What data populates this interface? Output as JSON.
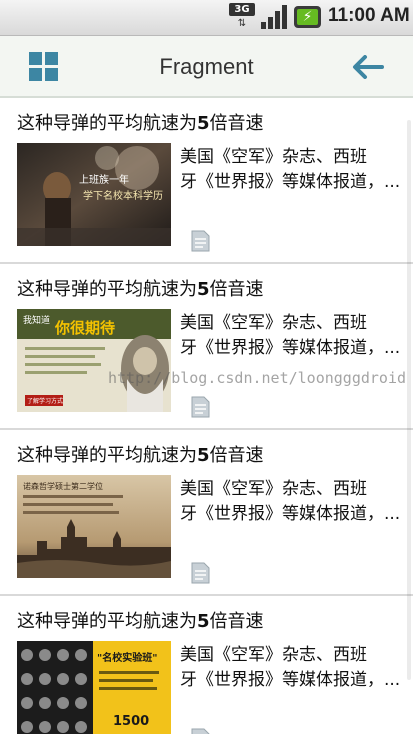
{
  "status_bar": {
    "network": "3G",
    "time": "11:00 AM",
    "icons": [
      "network-3g-icon",
      "signal-icon",
      "battery-charging-icon"
    ]
  },
  "action_bar": {
    "title": "Fragment",
    "left_icon": "grid-menu-icon",
    "right_icon": "back-arrow-icon",
    "accent_color": "#3d86a3"
  },
  "items": [
    {
      "title_pre": "这种导弹的平均航速为",
      "title_bold": "5",
      "title_post": "倍音速",
      "desc_line1": "美国《空军》杂志、西班",
      "desc_line2": "牙《世界报》等媒体报道，...",
      "image": "street-crowd-photo",
      "image_text": "上班族一年 学下名校本科学历"
    },
    {
      "title_pre": "这种导弹的平均航速为",
      "title_bold": "5",
      "title_post": "倍音速",
      "desc_line1": "美国《空军》杂志、西班",
      "desc_line2": "牙《世界报》等媒体报道，...",
      "image": "promo-darwin-poster",
      "image_text": "你很期待",
      "image_text2": "我知道",
      "image_button": "了解学习方式"
    },
    {
      "title_pre": "这种导弹的平均航速为",
      "title_bold": "5",
      "title_post": "倍音速",
      "desc_line1": "美国《空军》杂志、西班",
      "desc_line2": "牙《世界报》等媒体报道，...",
      "image": "london-skyline-photo",
      "image_text": "诺森哲学硕士第二学位"
    },
    {
      "title_pre": "这种导弹的平均航速为",
      "title_bold": "5",
      "title_post": "倍音速",
      "desc_line1": "美国《空军》杂志、西班",
      "desc_line2": "牙《世界报》等媒体报道，...",
      "image": "teachers-portrait-grid",
      "image_text": "\"名校实验班\"",
      "image_price": "1500"
    }
  ],
  "watermark": "http://blog.csdn.net/loongggdroid"
}
